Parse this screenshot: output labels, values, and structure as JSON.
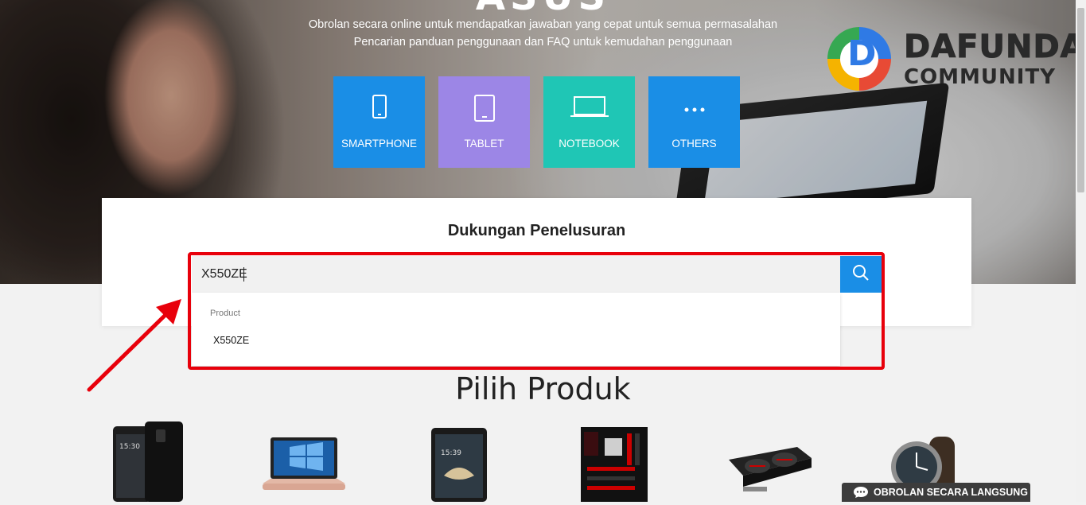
{
  "hero": {
    "heading": "ASUS",
    "subtitle_line1": "Obrolan secara online untuk mendapatkan jawaban yang cepat untuk semua permasalahan",
    "subtitle_line2": "Pencarian panduan penggunaan dan FAQ untuk kemudahan penggunaan",
    "tiles": [
      {
        "label": "SMARTPHONE",
        "icon": "smartphone-icon",
        "color": "#1a8ee6"
      },
      {
        "label": "TABLET",
        "icon": "tablet-icon",
        "color": "#9c86e6"
      },
      {
        "label": "NOTEBOOK",
        "icon": "notebook-icon",
        "color": "#1fc6b5"
      },
      {
        "label": "OTHERS",
        "icon": "more-icon",
        "color": "#1a8ee6"
      }
    ]
  },
  "watermark": {
    "line1": "DAFUNDA",
    "line2": "COMMUNITY"
  },
  "search": {
    "title": "Dukungan Penelusuran",
    "value": "X550ZE",
    "button_icon": "search-icon",
    "button_color": "#1a8ee6",
    "suggestions": {
      "header": "Product",
      "items": [
        "X550ZE"
      ]
    }
  },
  "annotation": {
    "color": "#e8000b"
  },
  "products": {
    "title": "Pilih Produk",
    "items": [
      {
        "icon": "phone-product-icon"
      },
      {
        "icon": "laptop-product-icon"
      },
      {
        "icon": "tablet-product-icon"
      },
      {
        "icon": "motherboard-product-icon"
      },
      {
        "icon": "graphics-card-product-icon"
      },
      {
        "icon": "smartwatch-product-icon"
      }
    ]
  },
  "chat": {
    "label": "OBROLAN SECARA LANGSUNG",
    "icon": "chat-icon"
  }
}
